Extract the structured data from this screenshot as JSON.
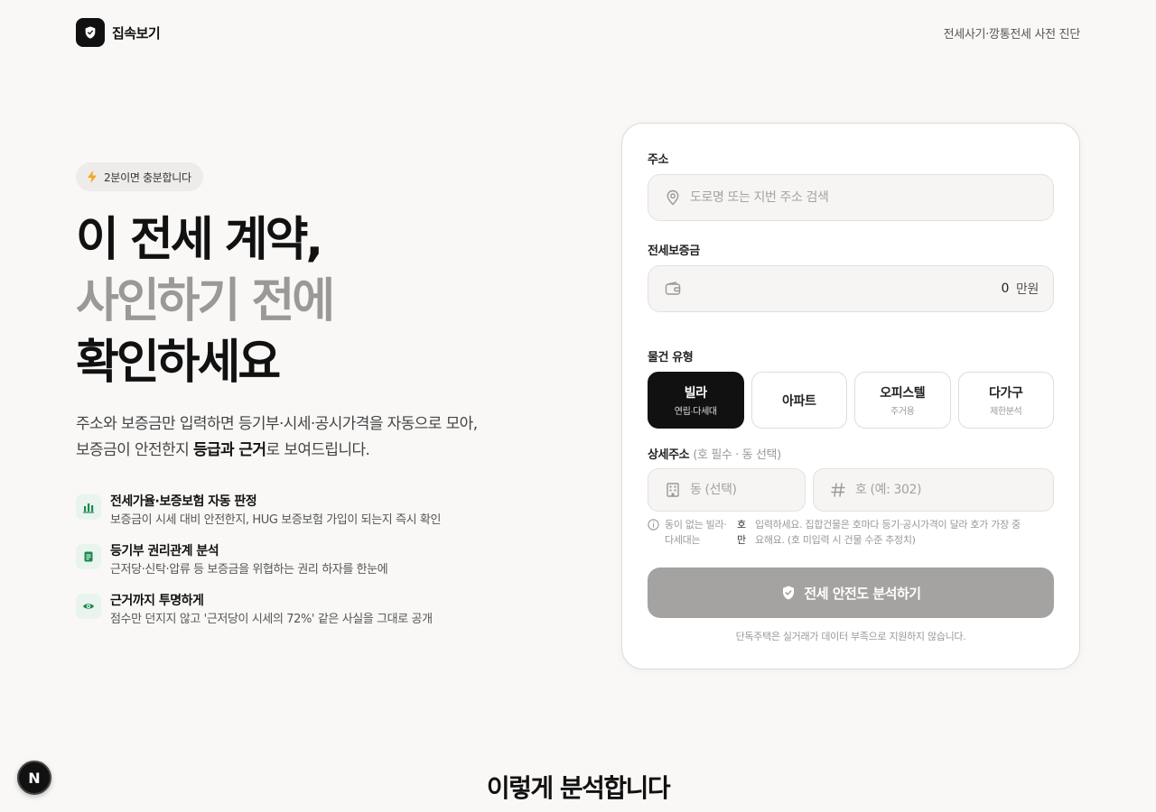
{
  "header": {
    "brand_name": "집속보기",
    "tagline": "전세사기·깡통전세 사전 진단"
  },
  "hero": {
    "badge": "2분이면 충분합니다",
    "title_line1": "이 전세 계약,",
    "title_line2": "사인하기 전에",
    "title_line3": "확인하세요",
    "desc_part1": "주소와 보증금만 입력하면 등기부·시세·공시가격을 자동으로 모아, 보증금이 안전한지 ",
    "desc_bold": "등급과 근거",
    "desc_part2": "로 보여드립니다."
  },
  "features": [
    {
      "title": "전세가율·보증보험 자동 판정",
      "desc": "보증금이 시세 대비 안전한지, HUG 보증보험 가입이 되는지 즉시 확인",
      "icon": "bar-chart-icon"
    },
    {
      "title": "등기부 권리관계 분석",
      "desc": "근저당·신탁·압류 등 보증금을 위협하는 권리 하자를 한눈에",
      "icon": "document-icon"
    },
    {
      "title": "근거까지 투명하게",
      "desc": "점수만 던지지 않고 '근저당이 시세의 72%' 같은 사실을 그대로 공개",
      "icon": "eye-icon"
    }
  ],
  "form": {
    "address_label": "주소",
    "address_placeholder": "도로명 또는 지번 주소 검색",
    "deposit_label": "전세보증금",
    "deposit_value": "0",
    "deposit_unit": "만원",
    "type_label": "물건 유형",
    "types": [
      {
        "name": "빌라",
        "sub": "연립·다세대",
        "active": true
      },
      {
        "name": "아파트",
        "sub": "",
        "active": false
      },
      {
        "name": "오피스텔",
        "sub": "주거용",
        "active": false
      },
      {
        "name": "다가구",
        "sub": "제한분석",
        "active": false
      }
    ],
    "detail_label": "상세주소",
    "detail_hint": "(호 필수 · 동 선택)",
    "dong_placeholder": "동 (선택)",
    "ho_placeholder": "호 (예: 302)",
    "note_part1": "동이 없는 빌라·다세대는",
    "note_part2": "호만",
    "note_part3": "입력하세요. 집합건물은 호마다 등기·공시가격이 달라 호가 가장 중요해요. (호 미입력 시 건물 수준 추정치)",
    "submit_label": "전세 안전도 분석하기",
    "footnote": "단독주택은 실거래가 데이터 부족으로 지원하지 않습니다."
  },
  "section": {
    "title": "이렇게 분석합니다"
  },
  "fab": {
    "label": "N"
  },
  "colors": {
    "accent": "#111111",
    "feature_icon_bg": "#e9f4ee",
    "feature_icon": "#1a8a4f",
    "badge_icon": "#f5a623",
    "submit_disabled": "#a4a3a2"
  }
}
